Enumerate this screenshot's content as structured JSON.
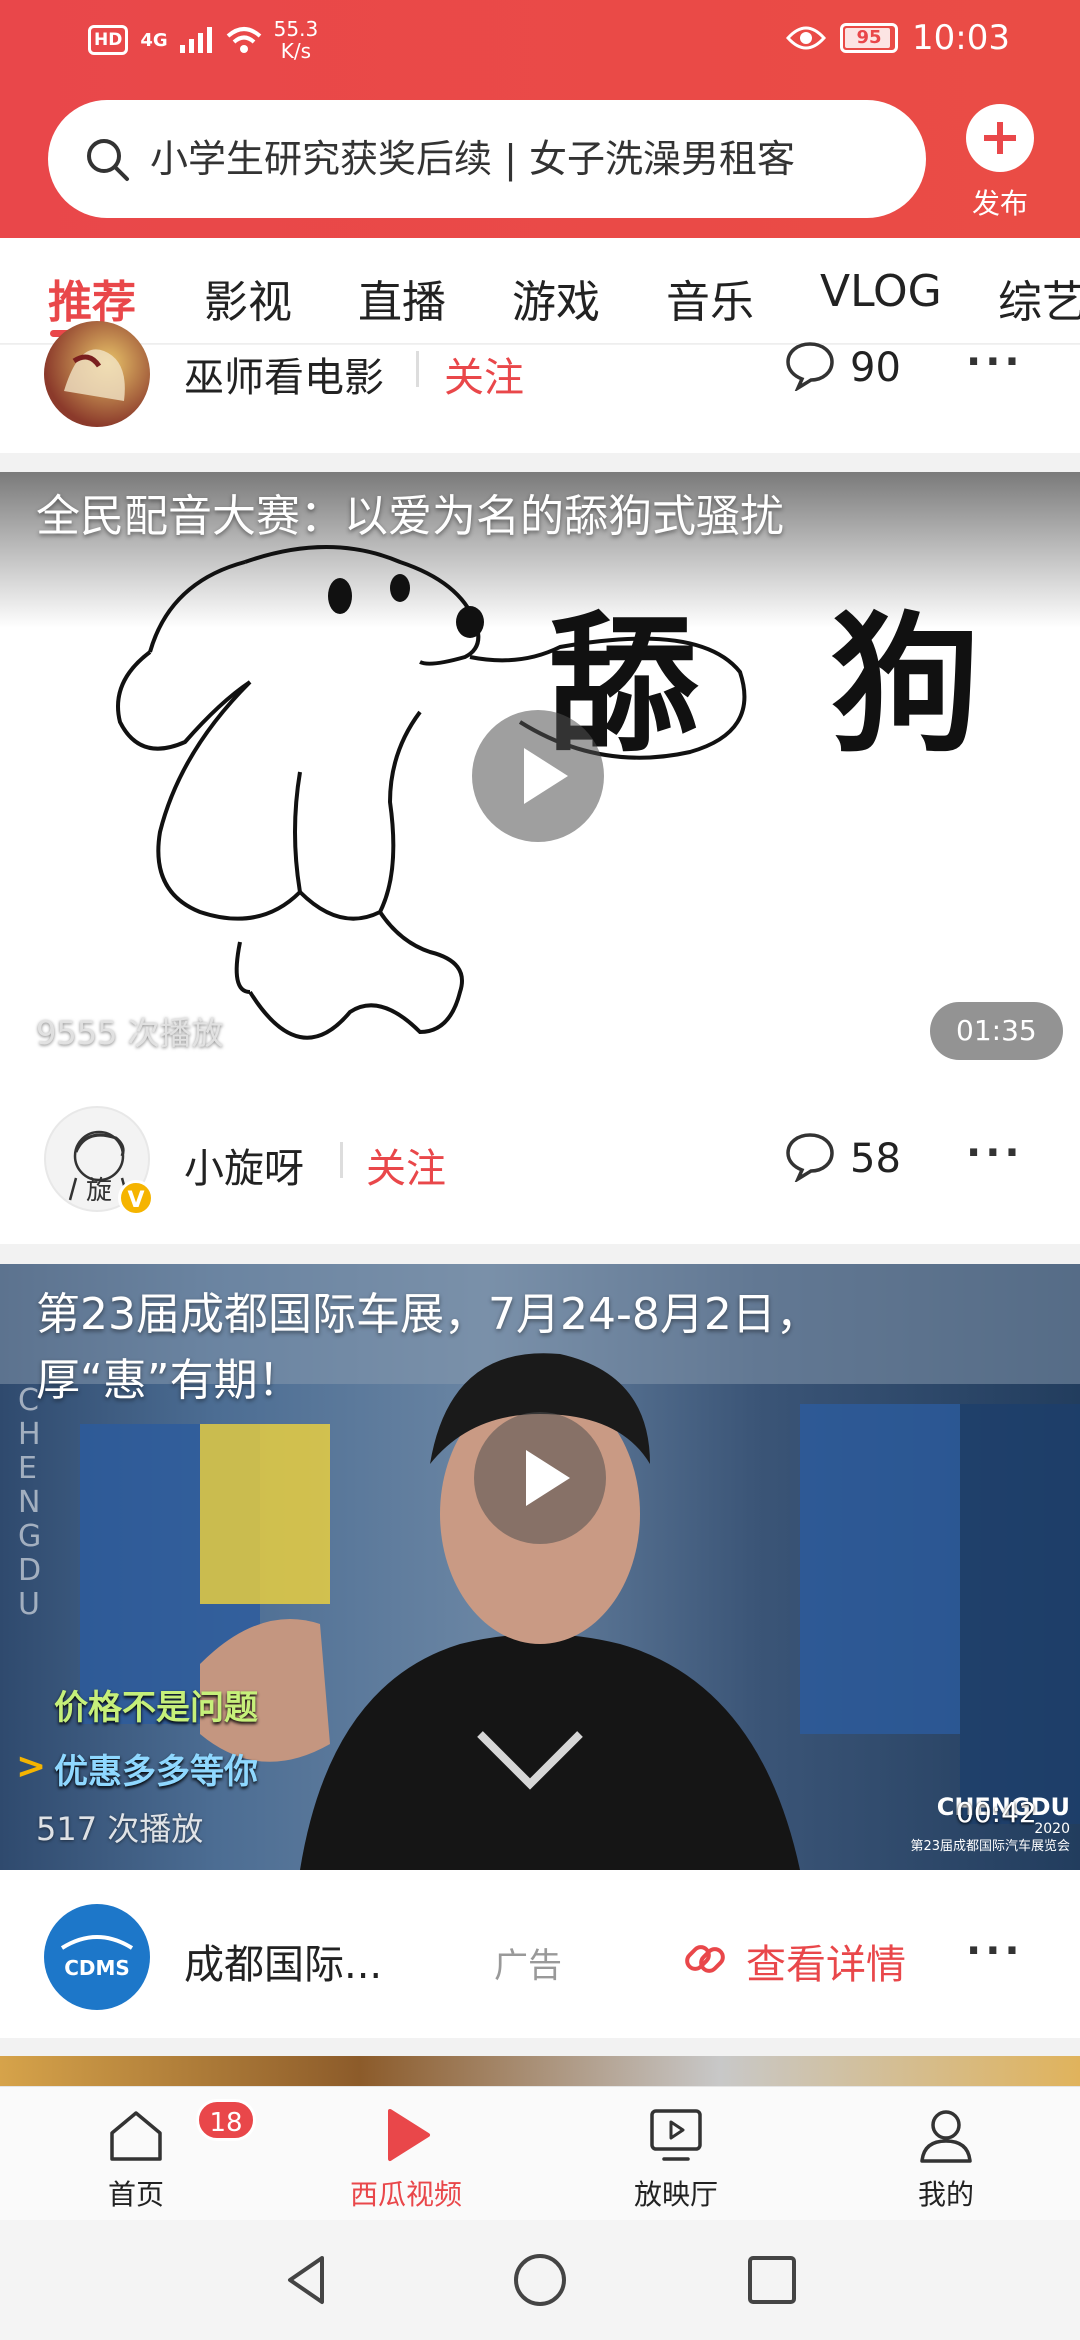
{
  "status_bar": {
    "hd": "HD",
    "network": "4G",
    "speed_value": "55.3",
    "speed_unit": "K/s",
    "battery": "95",
    "battery_level": 0.95,
    "time": "10:03"
  },
  "search": {
    "text": "小学生研究获奖后续 | 女子洗澡男租客"
  },
  "publish": {
    "label": "发布"
  },
  "tabs": [
    {
      "label": "推荐",
      "active": true
    },
    {
      "label": "影视"
    },
    {
      "label": "直播"
    },
    {
      "label": "游戏"
    },
    {
      "label": "音乐"
    },
    {
      "label": "VLOG"
    },
    {
      "label": "综艺"
    }
  ],
  "feed": {
    "item0": {
      "author": "巫师看电影",
      "follow": "关注",
      "comments": "90"
    },
    "item1": {
      "title": "全民配音大赛：以爱为名的舔狗式骚扰",
      "overlay_text": "舔  狗",
      "views": "9555 次播放",
      "duration": "01:35",
      "author": "小旋呀",
      "avatar_char": "旋",
      "verified": "V",
      "follow": "关注",
      "comments": "58"
    },
    "item2": {
      "title_line1": "第23届成都国际车展，7月24-8月2日，",
      "title_line2": "厚“惠”有期！",
      "caption1": "价格不是问题",
      "caption2": "优惠多多等你",
      "side_text": "CHENGDU",
      "watermark1": "CHENGDU",
      "watermark2": "2020",
      "watermark3": "第23届成都国际汽车展览会",
      "views": "517 次播放",
      "duration": "00:42",
      "author": "成都国际...",
      "logo_text": "CDMS",
      "ad_label": "广告",
      "detail_label": "查看详情"
    }
  },
  "bottom_nav": [
    {
      "label": "首页",
      "badge": "18"
    },
    {
      "label": "西瓜视频",
      "active": true
    },
    {
      "label": "放映厅"
    },
    {
      "label": "我的"
    }
  ],
  "colors": {
    "brand": "#e9474a",
    "text": "#222222"
  }
}
